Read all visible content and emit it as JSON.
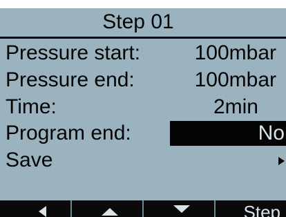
{
  "title": "Step 01",
  "rows": [
    {
      "label": "Pressure start:",
      "value": "100mbar"
    },
    {
      "label": "Pressure end:",
      "value": "100mbar"
    },
    {
      "label": "Time:",
      "value": "2min"
    },
    {
      "label": "Program end:",
      "value": "No"
    },
    {
      "label": "Save",
      "value": ""
    }
  ],
  "softkeys": {
    "left_icon": "arrow-left-icon",
    "up_icon": "arrow-up-icon",
    "down_icon": "arrow-down-icon",
    "step_label": "Step"
  },
  "colors": {
    "lcd_background": "#9bb3bf",
    "text": "#050505",
    "inverse_text": "#d9e4ea",
    "selection": "#050505"
  }
}
